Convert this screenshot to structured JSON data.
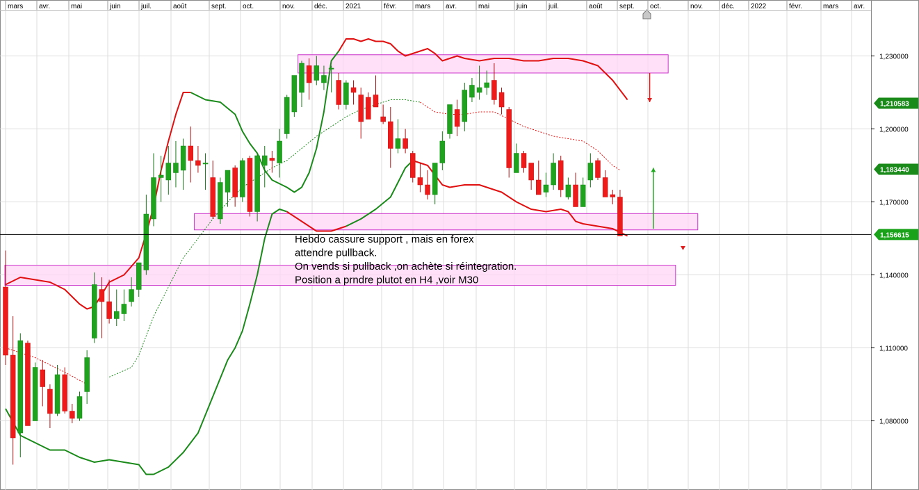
{
  "chart_data": {
    "type": "candlestick",
    "timeframe_note": "weekly",
    "x_tick_labels": [
      "mars",
      "avr.",
      "mai",
      "juin",
      "juil.",
      "août",
      "sept.",
      "oct.",
      "nov.",
      "déc.",
      "2021",
      "févr.",
      "mars",
      "avr.",
      "mai",
      "juin",
      "juil.",
      "août",
      "sept.",
      "oct.",
      "nov.",
      "déc.",
      "2022",
      "févr.",
      "mars",
      "avr."
    ],
    "y_ticks": [
      "1,230000",
      "1,200000",
      "1,170000",
      "1,140000",
      "1,110000",
      "1,080000"
    ],
    "y_tick_values": [
      1.23,
      1.2,
      1.17,
      1.14,
      1.11,
      1.08
    ],
    "ylim": [
      1.059,
      1.25
    ],
    "grid": true,
    "price_badges": [
      {
        "label": "1,210583",
        "value": 1.210583,
        "color": "#1a8a1a"
      },
      {
        "label": "1,183440",
        "value": 1.18344,
        "color": "#1a8a1a"
      },
      {
        "label": "1,156615",
        "value": 1.156615,
        "color": "#1aa31a"
      }
    ],
    "current_price_line": 1.156615,
    "candles": [
      [
        1.135,
        1.15,
        1.103,
        1.107
      ],
      [
        1.107,
        1.123,
        1.062,
        1.073
      ],
      [
        1.075,
        1.116,
        1.065,
        1.113
      ],
      [
        1.112,
        1.113,
        1.082,
        1.078
      ],
      [
        1.08,
        1.104,
        1.08,
        1.102
      ],
      [
        1.101,
        1.105,
        1.086,
        1.094
      ],
      [
        1.093,
        1.095,
        1.077,
        1.083
      ],
      [
        1.083,
        1.103,
        1.082,
        1.099
      ],
      [
        1.099,
        1.102,
        1.083,
        1.084
      ],
      [
        1.084,
        1.087,
        1.079,
        1.081
      ],
      [
        1.081,
        1.092,
        1.08,
        1.09
      ],
      [
        1.092,
        1.109,
        1.087,
        1.106
      ],
      [
        1.114,
        1.141,
        1.112,
        1.136
      ],
      [
        1.134,
        1.139,
        1.114,
        1.129
      ],
      [
        1.129,
        1.138,
        1.12,
        1.122
      ],
      [
        1.122,
        1.134,
        1.119,
        1.125
      ],
      [
        1.124,
        1.134,
        1.121,
        1.128
      ],
      [
        1.129,
        1.139,
        1.127,
        1.134
      ],
      [
        1.134,
        1.145,
        1.131,
        1.145
      ],
      [
        1.142,
        1.173,
        1.14,
        1.165
      ],
      [
        1.163,
        1.19,
        1.16,
        1.18
      ],
      [
        1.18,
        1.189,
        1.17,
        1.181
      ],
      [
        1.179,
        1.193,
        1.173,
        1.186
      ],
      [
        1.182,
        1.195,
        1.176,
        1.186
      ],
      [
        1.183,
        1.196,
        1.175,
        1.193
      ],
      [
        1.193,
        1.201,
        1.178,
        1.187
      ],
      [
        1.187,
        1.193,
        1.182,
        1.185
      ],
      [
        1.186,
        1.19,
        1.175,
        1.186
      ],
      [
        1.18,
        1.187,
        1.163,
        1.164
      ],
      [
        1.163,
        1.18,
        1.161,
        1.178
      ],
      [
        1.174,
        1.182,
        1.168,
        1.183
      ],
      [
        1.184,
        1.185,
        1.168,
        1.172
      ],
      [
        1.172,
        1.188,
        1.17,
        1.187
      ],
      [
        1.188,
        1.189,
        1.164,
        1.166
      ],
      [
        1.166,
        1.19,
        1.162,
        1.189
      ],
      [
        1.185,
        1.193,
        1.176,
        1.189
      ],
      [
        1.188,
        1.191,
        1.182,
        1.187
      ],
      [
        1.186,
        1.2,
        1.18,
        1.195
      ],
      [
        1.198,
        1.214,
        1.196,
        1.213
      ],
      [
        1.207,
        1.221,
        1.205,
        1.222
      ],
      [
        1.215,
        1.228,
        1.209,
        1.227
      ],
      [
        1.226,
        1.229,
        1.212,
        1.219
      ],
      [
        1.22,
        1.23,
        1.218,
        1.226
      ],
      [
        1.219,
        1.226,
        1.216,
        1.222
      ],
      [
        1.225,
        1.226,
        1.215,
        1.225
      ],
      [
        1.22,
        1.223,
        1.208,
        1.21
      ],
      [
        1.21,
        1.22,
        1.208,
        1.219
      ],
      [
        1.217,
        1.22,
        1.21,
        1.215
      ],
      [
        1.214,
        1.217,
        1.196,
        1.203
      ],
      [
        1.213,
        1.215,
        1.206,
        1.204
      ],
      [
        1.214,
        1.222,
        1.209,
        1.209
      ],
      [
        1.205,
        1.21,
        1.202,
        1.203
      ],
      [
        1.203,
        1.209,
        1.184,
        1.192
      ],
      [
        1.192,
        1.204,
        1.19,
        1.196
      ],
      [
        1.196,
        1.2,
        1.19,
        1.192
      ],
      [
        1.19,
        1.191,
        1.178,
        1.18
      ],
      [
        1.18,
        1.186,
        1.174,
        1.177
      ],
      [
        1.177,
        1.183,
        1.171,
        1.173
      ],
      [
        1.173,
        1.183,
        1.169,
        1.186
      ],
      [
        1.186,
        1.199,
        1.183,
        1.195
      ],
      [
        1.198,
        1.21,
        1.196,
        1.21
      ],
      [
        1.208,
        1.212,
        1.197,
        1.201
      ],
      [
        1.203,
        1.219,
        1.199,
        1.216
      ],
      [
        1.213,
        1.221,
        1.211,
        1.218
      ],
      [
        1.215,
        1.226,
        1.212,
        1.217
      ],
      [
        1.217,
        1.224,
        1.214,
        1.219
      ],
      [
        1.22,
        1.227,
        1.21,
        1.212
      ],
      [
        1.215,
        1.217,
        1.206,
        1.209
      ],
      [
        1.208,
        1.209,
        1.18,
        1.184
      ],
      [
        1.182,
        1.194,
        1.182,
        1.19
      ],
      [
        1.19,
        1.191,
        1.182,
        1.184
      ],
      [
        1.186,
        1.186,
        1.175,
        1.179
      ],
      [
        1.179,
        1.187,
        1.173,
        1.173
      ],
      [
        1.174,
        1.182,
        1.172,
        1.177
      ],
      [
        1.177,
        1.19,
        1.175,
        1.186
      ],
      [
        1.187,
        1.189,
        1.172,
        1.175
      ],
      [
        1.172,
        1.18,
        1.171,
        1.177
      ],
      [
        1.177,
        1.182,
        1.168,
        1.168
      ],
      [
        1.168,
        1.18,
        1.168,
        1.177
      ],
      [
        1.179,
        1.19,
        1.176,
        1.186
      ],
      [
        1.187,
        1.188,
        1.179,
        1.18
      ],
      [
        1.18,
        1.183,
        1.172,
        1.172
      ],
      [
        1.173,
        1.175,
        1.169,
        1.172
      ],
      [
        1.172,
        1.175,
        1.158,
        1.156
      ]
    ],
    "indicators": [
      {
        "name": "upper-band",
        "style": "solid",
        "points": [
          [
            0,
            1.136
          ],
          [
            2,
            1.139
          ],
          [
            4,
            1.138
          ],
          [
            6,
            1.137
          ],
          [
            8,
            1.134
          ],
          [
            10,
            1.128
          ],
          [
            11,
            1.126
          ],
          [
            12,
            1.127
          ],
          [
            14,
            1.137
          ],
          [
            16,
            1.14
          ],
          [
            18,
            1.147
          ],
          [
            19,
            1.157
          ],
          [
            20,
            1.168
          ],
          [
            21,
            1.183
          ],
          [
            22,
            1.195
          ],
          [
            23,
            1.206
          ],
          [
            24,
            1.215
          ],
          [
            25,
            1.215
          ],
          [
            27,
            1.212
          ],
          [
            29,
            1.211
          ],
          [
            31,
            1.206
          ],
          [
            32,
            1.199
          ],
          [
            33,
            1.194
          ],
          [
            34,
            1.19
          ],
          [
            35,
            1.183
          ],
          [
            36,
            1.179
          ],
          [
            38,
            1.176
          ],
          [
            39,
            1.174
          ],
          [
            40,
            1.176
          ],
          [
            41,
            1.182
          ],
          [
            42,
            1.192
          ],
          [
            43,
            1.207
          ],
          [
            44,
            1.228
          ],
          [
            45,
            1.232
          ],
          [
            46,
            1.237
          ],
          [
            47,
            1.237
          ],
          [
            48,
            1.236
          ],
          [
            49,
            1.237
          ],
          [
            50,
            1.236
          ],
          [
            51,
            1.236
          ],
          [
            52,
            1.235
          ],
          [
            53,
            1.232
          ],
          [
            54,
            1.23
          ],
          [
            55,
            1.231
          ],
          [
            56,
            1.232
          ],
          [
            57,
            1.233
          ],
          [
            58,
            1.231
          ],
          [
            59,
            1.228
          ],
          [
            60,
            1.229
          ],
          [
            61,
            1.23
          ],
          [
            62,
            1.229
          ],
          [
            64,
            1.228
          ],
          [
            66,
            1.229
          ],
          [
            68,
            1.229
          ],
          [
            70,
            1.228
          ],
          [
            72,
            1.228
          ],
          [
            74,
            1.229
          ],
          [
            76,
            1.229
          ],
          [
            78,
            1.228
          ],
          [
            80,
            1.226
          ],
          [
            82,
            1.22
          ],
          [
            84,
            1.212
          ]
        ]
      },
      {
        "name": "lower-band",
        "style": "solid",
        "points": [
          [
            0,
            1.085
          ],
          [
            2,
            1.074
          ],
          [
            4,
            1.071
          ],
          [
            6,
            1.068
          ],
          [
            8,
            1.068
          ],
          [
            10,
            1.065
          ],
          [
            12,
            1.063
          ],
          [
            14,
            1.064
          ],
          [
            16,
            1.063
          ],
          [
            18,
            1.062
          ],
          [
            19,
            1.058
          ],
          [
            20,
            1.058
          ],
          [
            22,
            1.061
          ],
          [
            24,
            1.067
          ],
          [
            26,
            1.075
          ],
          [
            28,
            1.09
          ],
          [
            30,
            1.105
          ],
          [
            31,
            1.11
          ],
          [
            32,
            1.117
          ],
          [
            33,
            1.128
          ],
          [
            34,
            1.14
          ],
          [
            35,
            1.155
          ],
          [
            36,
            1.165
          ],
          [
            37,
            1.167
          ],
          [
            38,
            1.166
          ],
          [
            40,
            1.162
          ],
          [
            42,
            1.158
          ],
          [
            44,
            1.158
          ],
          [
            46,
            1.16
          ],
          [
            48,
            1.163
          ],
          [
            50,
            1.167
          ],
          [
            52,
            1.172
          ],
          [
            53,
            1.178
          ],
          [
            54,
            1.184
          ],
          [
            55,
            1.187
          ],
          [
            57,
            1.185
          ],
          [
            58,
            1.181
          ],
          [
            59,
            1.177
          ],
          [
            60,
            1.176
          ],
          [
            62,
            1.177
          ],
          [
            64,
            1.177
          ],
          [
            66,
            1.175
          ],
          [
            67,
            1.174
          ],
          [
            69,
            1.17
          ],
          [
            71,
            1.167
          ],
          [
            73,
            1.166
          ],
          [
            75,
            1.167
          ],
          [
            76,
            1.166
          ],
          [
            77,
            1.162
          ],
          [
            78,
            1.161
          ],
          [
            80,
            1.16
          ],
          [
            82,
            1.159
          ],
          [
            84,
            1.156
          ]
        ]
      },
      {
        "name": "middle-line",
        "style": "dotted",
        "points": [
          [
            0,
            1.11
          ],
          [
            4,
            1.106
          ],
          [
            8,
            1.1
          ],
          [
            11,
            1.095
          ],
          [
            14,
            1.098
          ],
          [
            17,
            1.102
          ],
          [
            18,
            1.107
          ],
          [
            20,
            1.123
          ],
          [
            22,
            1.135
          ],
          [
            24,
            1.147
          ],
          [
            26,
            1.155
          ],
          [
            28,
            1.163
          ],
          [
            30,
            1.17
          ],
          [
            32,
            1.176
          ],
          [
            34,
            1.18
          ],
          [
            36,
            1.184
          ],
          [
            38,
            1.187
          ],
          [
            40,
            1.192
          ],
          [
            42,
            1.197
          ],
          [
            44,
            1.201
          ],
          [
            46,
            1.205
          ],
          [
            48,
            1.208
          ],
          [
            50,
            1.21
          ],
          [
            52,
            1.212
          ],
          [
            54,
            1.212
          ],
          [
            56,
            1.211
          ],
          [
            58,
            1.207
          ],
          [
            60,
            1.206
          ],
          [
            62,
            1.206
          ],
          [
            64,
            1.207
          ],
          [
            66,
            1.207
          ],
          [
            68,
            1.204
          ],
          [
            70,
            1.201
          ],
          [
            72,
            1.199
          ],
          [
            74,
            1.197
          ],
          [
            76,
            1.196
          ],
          [
            78,
            1.195
          ],
          [
            80,
            1.191
          ],
          [
            82,
            1.185
          ],
          [
            83,
            1.183
          ]
        ]
      }
    ],
    "zones": [
      {
        "name": "resistance-zone",
        "x0": 39.5,
        "x1": 89.5,
        "y_top": 1.2305,
        "y_bottom": 1.223
      },
      {
        "name": "support-zone",
        "x0": 25.5,
        "x1": 93.5,
        "y_top": 1.1652,
        "y_bottom": 1.1585
      },
      {
        "name": "lower-zone",
        "x0": 0.0,
        "x1": 90.5,
        "y_top": 1.144,
        "y_bottom": 1.1357
      }
    ],
    "arrows": [
      {
        "name": "down-arrow",
        "x": 87,
        "y_from": 1.223,
        "y_to": 1.211,
        "color": "#e02020"
      },
      {
        "name": "up-arrow",
        "x": 87.5,
        "y_from": 1.159,
        "y_to": 1.184,
        "color": "#22aa22"
      }
    ],
    "small_markers": [
      {
        "name": "down-triangle-marker",
        "x": 91.5,
        "y": 1.151,
        "color": "#e02020"
      }
    ],
    "annotation": [
      "Hebdo cassure support , mais en forex",
      "attendre pullback.",
      "On vends si pullback ,on achète si réintegration.",
      "Position a prndre plutot en H4 ,voir M30"
    ]
  }
}
